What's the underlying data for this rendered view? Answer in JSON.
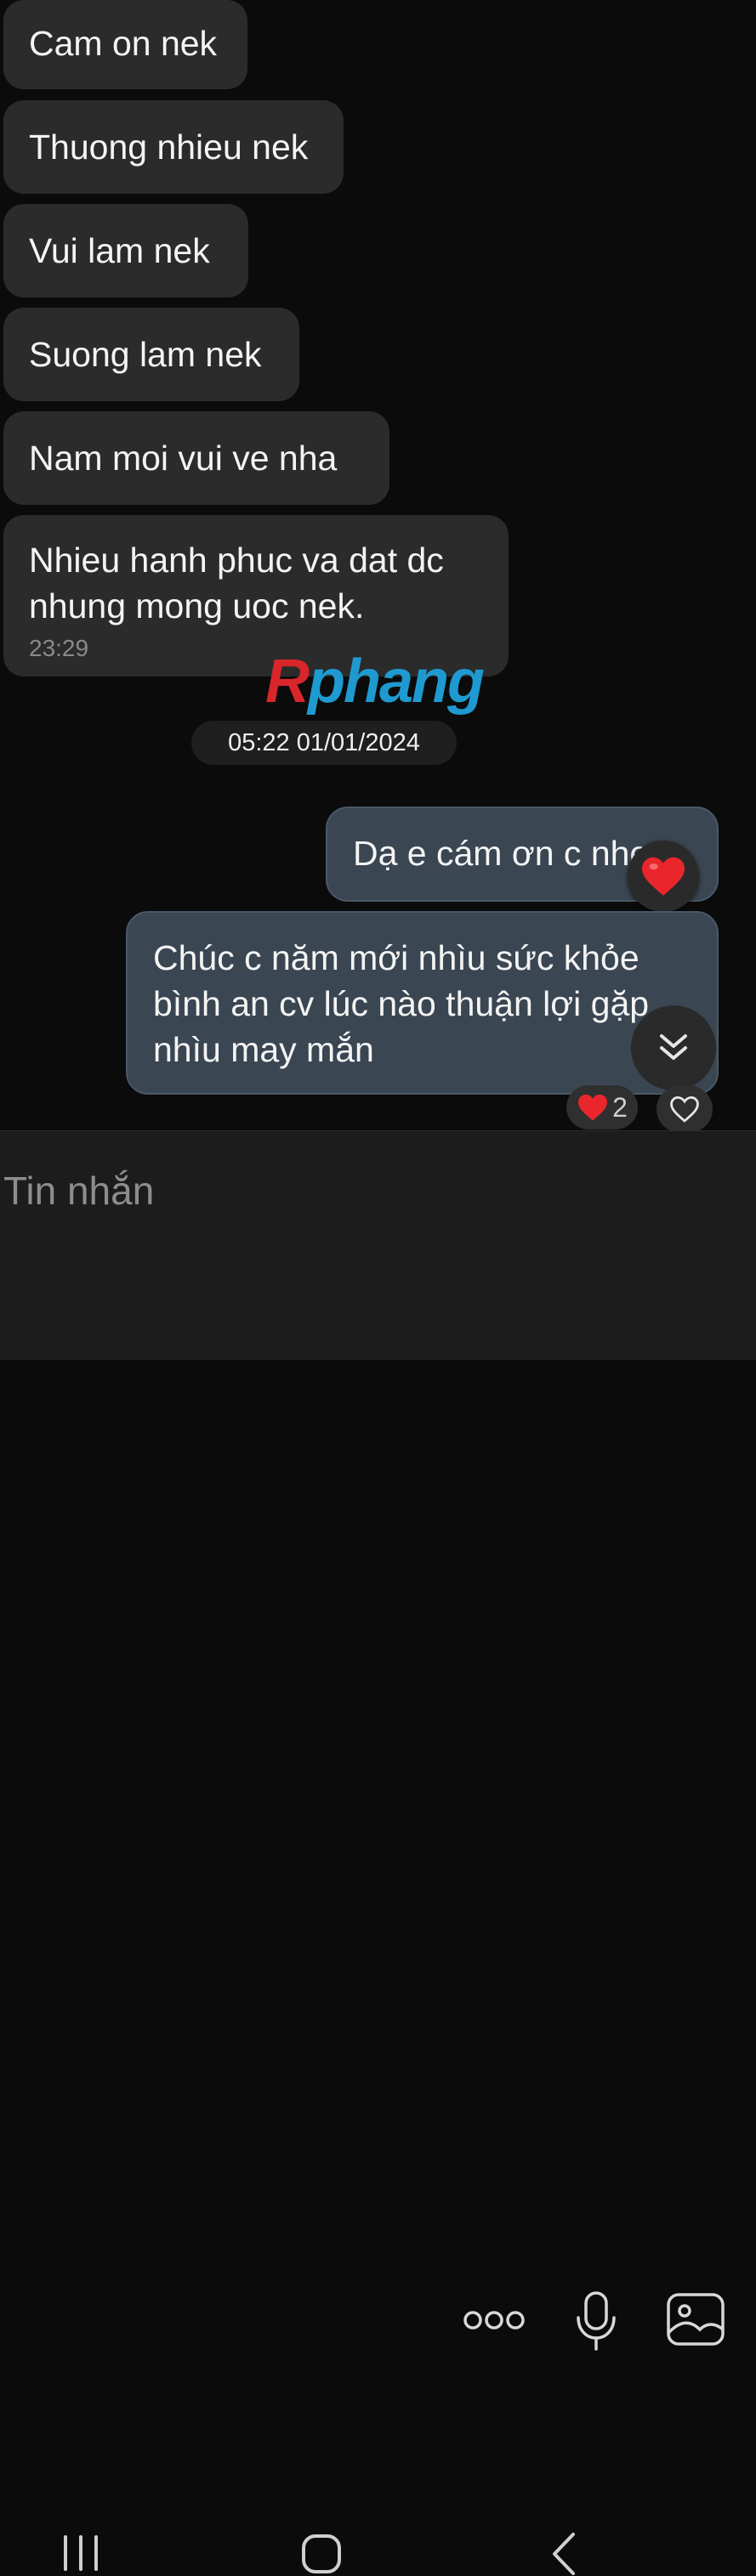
{
  "messages_in": [
    {
      "text": "Cam on nek"
    },
    {
      "text": "Thuong nhieu nek"
    },
    {
      "text": "Vui lam nek"
    },
    {
      "text": "Suong lam nek"
    },
    {
      "text": "Nam  moi vui ve nha"
    },
    {
      "line1": "Nhieu hanh phuc va dat dc",
      "line2": "nhung mong uoc nek.",
      "time": "23:29"
    }
  ],
  "watermark": {
    "first": "R",
    "rest": "phang"
  },
  "date_separator": "05:22 01/01/2024",
  "messages_out": [
    {
      "text": "Dạ e cám ơn c nhen"
    },
    {
      "line1": "Chúc c năm mới nhìu sức khỏe",
      "line2": "bình an cv lúc nào thuận lợi gặp",
      "line3": "nhìu may mắn"
    }
  ],
  "reactions": {
    "count": "2",
    "emoji_icon": "red-heart",
    "colors": {
      "heart": "#e8262c"
    }
  },
  "composer": {
    "placeholder": "Tin nhắn"
  },
  "icons": [
    "more-icon",
    "microphone-icon",
    "gallery-icon",
    "scroll-down-icon",
    "heart-outline-icon",
    "recent-apps-icon",
    "home-icon",
    "back-icon"
  ]
}
